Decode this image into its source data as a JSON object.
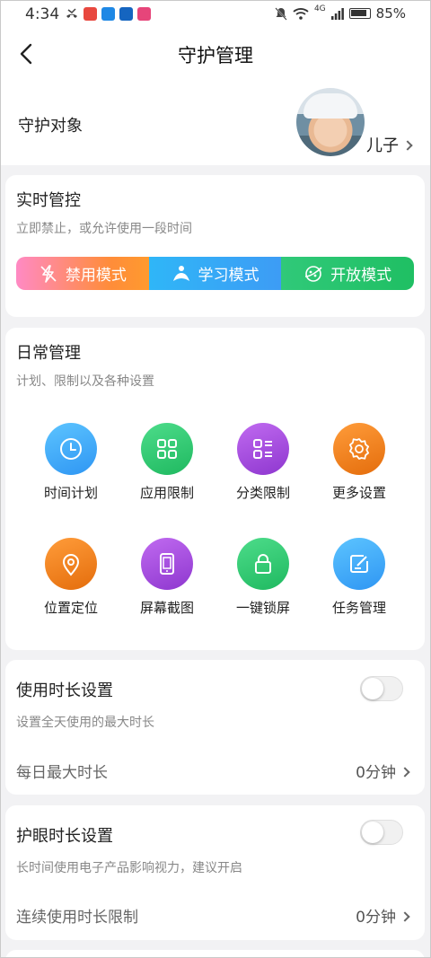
{
  "status_bar": {
    "time": "4:34",
    "battery": "85%",
    "network": "4G"
  },
  "header": {
    "title": "守护管理"
  },
  "target": {
    "label": "守护对象",
    "name": "儿子"
  },
  "realtime": {
    "title": "实时管控",
    "subtitle": "立即禁止，或允许使用一段时间",
    "modes": [
      {
        "label": "禁用模式",
        "icon": "ban-icon"
      },
      {
        "label": "学习模式",
        "icon": "study-icon"
      },
      {
        "label": "开放模式",
        "icon": "open-icon"
      }
    ]
  },
  "daily": {
    "title": "日常管理",
    "subtitle": "计划、限制以及各种设置",
    "items": [
      {
        "label": "时间计划",
        "icon": "clock-icon",
        "color": "#2fa3f5"
      },
      {
        "label": "应用限制",
        "icon": "apps-grid-icon",
        "color": "#27c26d"
      },
      {
        "label": "分类限制",
        "icon": "category-list-icon",
        "color": "#9b45d6"
      },
      {
        "label": "更多设置",
        "icon": "gear-icon",
        "color": "#f07a12"
      },
      {
        "label": "位置定位",
        "icon": "location-pin-icon",
        "color": "#f07a12"
      },
      {
        "label": "屏幕截图",
        "icon": "phone-screen-icon",
        "color": "#9b45d6"
      },
      {
        "label": "一键锁屏",
        "icon": "lock-icon",
        "color": "#27c26d"
      },
      {
        "label": "任务管理",
        "icon": "task-edit-icon",
        "color": "#2fa3f5"
      }
    ]
  },
  "usage_setting": {
    "title": "使用时长设置",
    "subtitle": "设置全天使用的最大时长",
    "row_label": "每日最大时长",
    "row_value": "0分钟",
    "enabled": false
  },
  "eye_setting": {
    "title": "护眼时长设置",
    "subtitle": "长时间使用电子产品影响视力，建议开启",
    "row_label": "连续使用时长限制",
    "row_value": "0分钟",
    "enabled": false
  }
}
